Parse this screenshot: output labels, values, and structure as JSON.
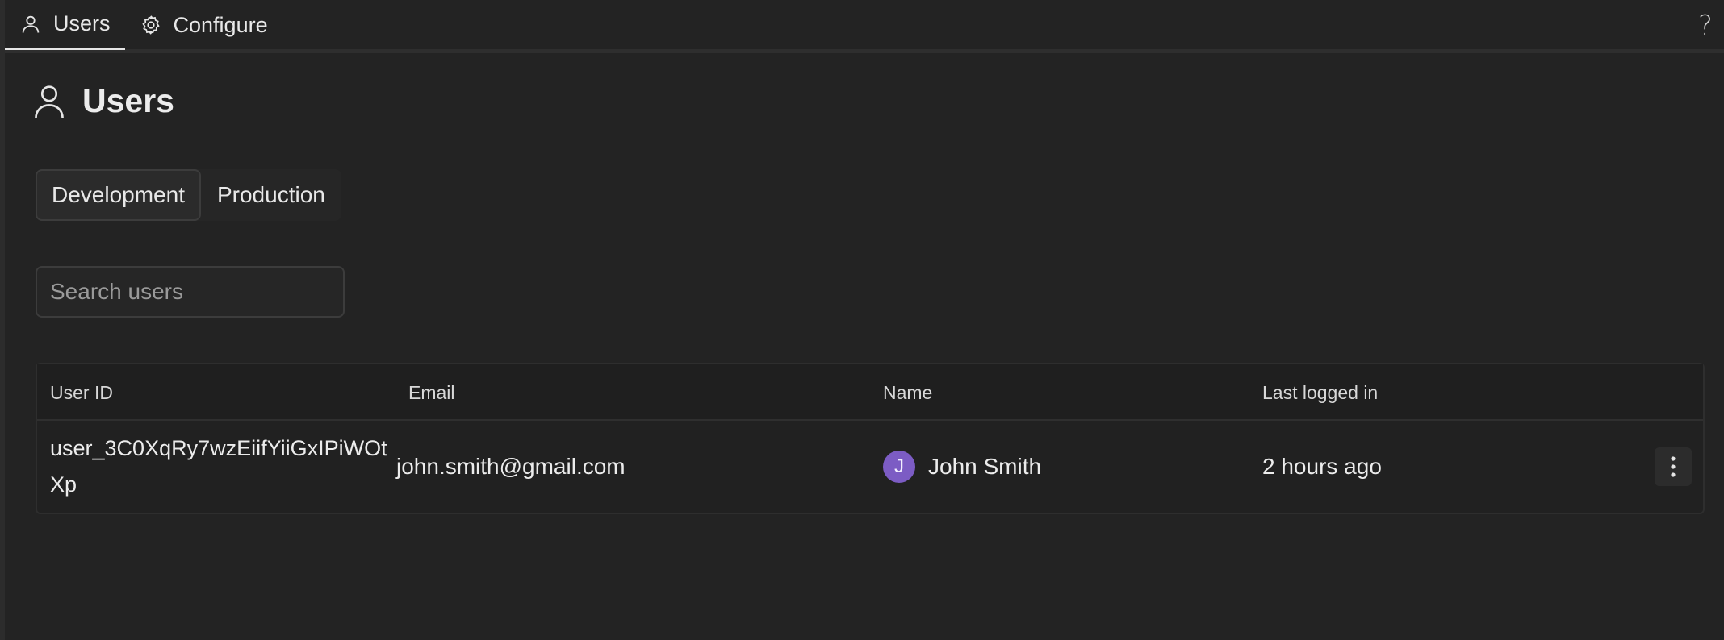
{
  "topbar": {
    "tabs": [
      {
        "label": "Users",
        "icon": "user-icon",
        "active": true
      },
      {
        "label": "Configure",
        "icon": "gear-icon",
        "active": false
      }
    ],
    "help": "?"
  },
  "page": {
    "title": "Users",
    "icon": "user-icon"
  },
  "env_tabs": [
    {
      "label": "Development",
      "active": true
    },
    {
      "label": "Production",
      "active": false
    }
  ],
  "search": {
    "placeholder": "Search users",
    "value": "",
    "icon": "search-icon"
  },
  "table": {
    "columns": [
      "User ID",
      "Email",
      "Name",
      "Last logged in"
    ],
    "rows": [
      {
        "user_id": "user_3C0XqRy7wzEiifYiiGxIPiWOtXp",
        "email": "john.smith@gmail.com",
        "avatar_initial": "J",
        "avatar_color": "#7c5cc4",
        "name": "John Smith",
        "last_logged_in": "2 hours ago",
        "menu_icon": "more-vertical-icon"
      }
    ]
  },
  "colors": {
    "background": "#232323",
    "text": "#e6e6e6",
    "accent": "#7c5cc4"
  }
}
